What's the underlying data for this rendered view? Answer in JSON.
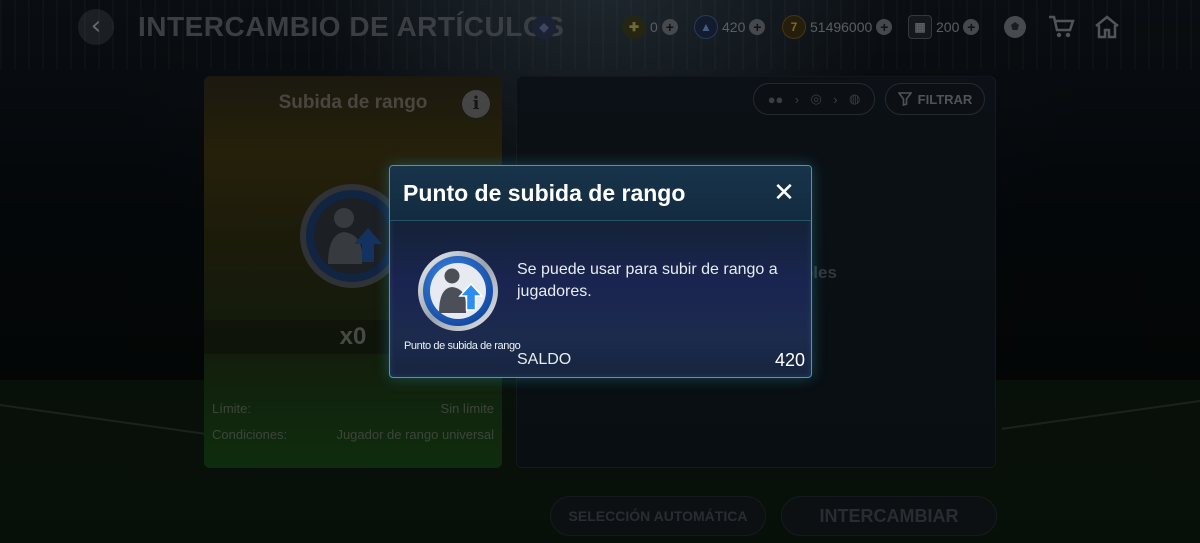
{
  "topbar": {
    "title": "INTERCAMBIO DE ARTÍCULOS",
    "currencies": [
      {
        "icon": "league-points-icon",
        "value": "0"
      },
      {
        "icon": "rank-up-point-icon",
        "value": "420"
      },
      {
        "icon": "fc-points-icon",
        "value": "51496000"
      },
      {
        "icon": "card-icon",
        "value": "200"
      }
    ],
    "icons": [
      "ball-icon",
      "cart-icon",
      "home-icon"
    ]
  },
  "left_panel": {
    "title": "Subida de rango",
    "count": "x0",
    "rows": [
      {
        "label": "Límite:",
        "value": "Sin límite"
      },
      {
        "label": "Condiciones:",
        "value": "Jugador de rango universal"
      }
    ]
  },
  "right_panel": {
    "filter_label": "FILTRAR",
    "empty_text_visible": "ponibles"
  },
  "bottom": {
    "auto_select_label": "SELECCIÓN AUTOMÁTICA",
    "exchange_label": "INTERCAMBIAR"
  },
  "modal": {
    "title": "Punto de subida de rango",
    "item_caption": "Punto de subida de rango",
    "description": "Se puede usar para subir de rango a jugadores.",
    "balance_label": "SALDO",
    "balance_value": "420"
  },
  "colors": {
    "modal_border": "#3f9fb1",
    "badge_blue": "#1f63c4",
    "arrow_blue": "#2b8ef0"
  }
}
